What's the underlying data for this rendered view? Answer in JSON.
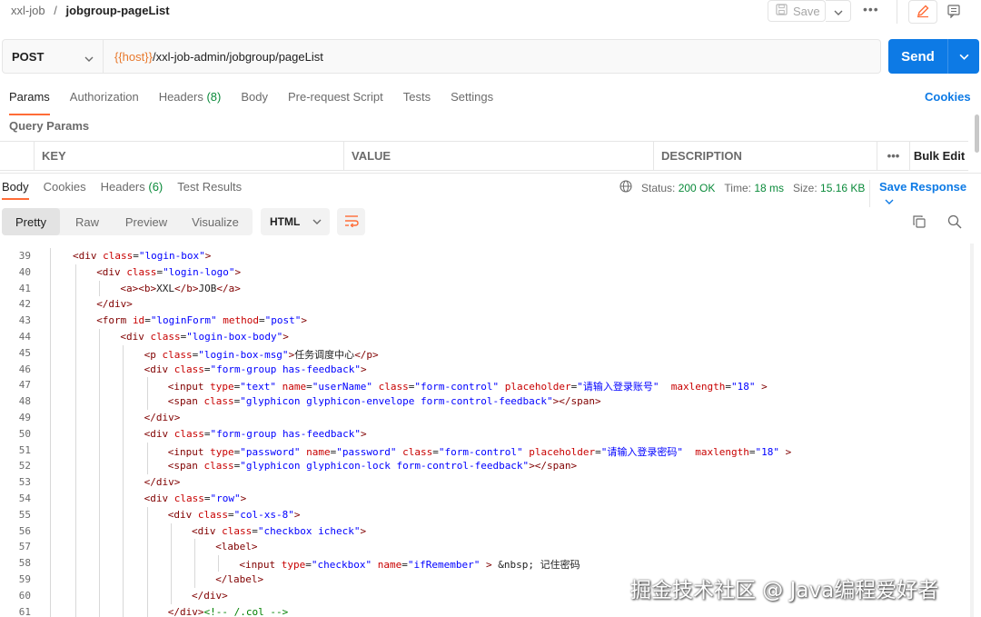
{
  "breadcrumb": {
    "collection": "xxl-job",
    "separator": "/",
    "request": "jobgroup-pageList"
  },
  "header": {
    "save_label": "Save",
    "more_label": "•••"
  },
  "request": {
    "method": "POST",
    "url_var": "{{host}}",
    "url_path": "/xxl-job-admin/jobgroup/pageList",
    "send_label": "Send"
  },
  "request_tabs": [
    {
      "label": "Params",
      "count": ""
    },
    {
      "label": "Authorization",
      "count": ""
    },
    {
      "label": "Headers",
      "count": "(8)"
    },
    {
      "label": "Body",
      "count": ""
    },
    {
      "label": "Pre-request Script",
      "count": ""
    },
    {
      "label": "Tests",
      "count": ""
    },
    {
      "label": "Settings",
      "count": ""
    }
  ],
  "cookies_label": "Cookies",
  "query_params_label": "Query Params",
  "params_table": {
    "key": "KEY",
    "value": "VALUE",
    "description": "DESCRIPTION",
    "more": "•••",
    "bulk_edit": "Bulk Edit"
  },
  "response_tabs": [
    {
      "label": "Body",
      "count": ""
    },
    {
      "label": "Cookies",
      "count": ""
    },
    {
      "label": "Headers",
      "count": "(6)"
    },
    {
      "label": "Test Results",
      "count": ""
    }
  ],
  "status": {
    "status_label": "Status:",
    "status_value": "200 OK",
    "time_label": "Time:",
    "time_value": "18 ms",
    "size_label": "Size:",
    "size_value": "15.16 KB"
  },
  "save_response_label": "Save Response",
  "view_modes": [
    "Pretty",
    "Raw",
    "Preview",
    "Visualize"
  ],
  "format": "HTML",
  "code_lines": [
    {
      "n": "39",
      "indent": 0,
      "html": "<span class=\"tag\">&lt;div</span> <span class=\"attr\">class</span>=<span class=\"val\">\"login-box\"</span><span class=\"tag\">&gt;</span>"
    },
    {
      "n": "40",
      "indent": 1,
      "html": "<span class=\"tag\">&lt;div</span> <span class=\"attr\">class</span>=<span class=\"val\">\"login-logo\"</span><span class=\"tag\">&gt;</span>"
    },
    {
      "n": "41",
      "indent": 2,
      "html": "<span class=\"tag\">&lt;a&gt;&lt;b&gt;</span>XXL<span class=\"tag\">&lt;/b&gt;</span>JOB<span class=\"tag\">&lt;/a&gt;</span>"
    },
    {
      "n": "42",
      "indent": 1,
      "html": "<span class=\"tag\">&lt;/div&gt;</span>"
    },
    {
      "n": "43",
      "indent": 1,
      "html": "<span class=\"tag\">&lt;form</span> <span class=\"attr\">id</span>=<span class=\"val\">\"loginForm\"</span> <span class=\"attr\">method</span>=<span class=\"val\">\"post\"</span><span class=\"tag\">&gt;</span>"
    },
    {
      "n": "44",
      "indent": 2,
      "html": "<span class=\"tag\">&lt;div</span> <span class=\"attr\">class</span>=<span class=\"val\">\"login-box-body\"</span><span class=\"tag\">&gt;</span>"
    },
    {
      "n": "45",
      "indent": 3,
      "html": "<span class=\"tag\">&lt;p</span> <span class=\"attr\">class</span>=<span class=\"val\">\"login-box-msg\"</span><span class=\"tag\">&gt;</span>任务调度中心<span class=\"tag\">&lt;/p&gt;</span>"
    },
    {
      "n": "46",
      "indent": 3,
      "html": "<span class=\"tag\">&lt;div</span> <span class=\"attr\">class</span>=<span class=\"val\">\"form-group has-feedback\"</span><span class=\"tag\">&gt;</span>"
    },
    {
      "n": "47",
      "indent": 4,
      "html": "<span class=\"tag\">&lt;input</span> <span class=\"attr\">type</span>=<span class=\"val\">\"text\"</span> <span class=\"attr\">name</span>=<span class=\"val\">\"userName\"</span> <span class=\"attr\">class</span>=<span class=\"val\">\"form-control\"</span> <span class=\"attr\">placeholder</span>=<span class=\"val\">\"请输入登录账号\"</span>  <span class=\"attr\">maxlength</span>=<span class=\"val\">\"18\"</span> <span class=\"tag\">&gt;</span>"
    },
    {
      "n": "48",
      "indent": 4,
      "html": "<span class=\"tag\">&lt;span</span> <span class=\"attr\">class</span>=<span class=\"val\">\"glyphicon glyphicon-envelope form-control-feedback\"</span><span class=\"tag\">&gt;&lt;/span&gt;</span>"
    },
    {
      "n": "49",
      "indent": 3,
      "html": "<span class=\"tag\">&lt;/div&gt;</span>"
    },
    {
      "n": "50",
      "indent": 3,
      "html": "<span class=\"tag\">&lt;div</span> <span class=\"attr\">class</span>=<span class=\"val\">\"form-group has-feedback\"</span><span class=\"tag\">&gt;</span>"
    },
    {
      "n": "51",
      "indent": 4,
      "html": "<span class=\"tag\">&lt;input</span> <span class=\"attr\">type</span>=<span class=\"val\">\"password\"</span> <span class=\"attr\">name</span>=<span class=\"val\">\"password\"</span> <span class=\"attr\">class</span>=<span class=\"val\">\"form-control\"</span> <span class=\"attr\">placeholder</span>=<span class=\"val\">\"请输入登录密码\"</span>  <span class=\"attr\">maxlength</span>=<span class=\"val\">\"18\"</span> <span class=\"tag\">&gt;</span>"
    },
    {
      "n": "52",
      "indent": 4,
      "html": "<span class=\"tag\">&lt;span</span> <span class=\"attr\">class</span>=<span class=\"val\">\"glyphicon glyphicon-lock form-control-feedback\"</span><span class=\"tag\">&gt;&lt;/span&gt;</span>"
    },
    {
      "n": "53",
      "indent": 3,
      "html": "<span class=\"tag\">&lt;/div&gt;</span>"
    },
    {
      "n": "54",
      "indent": 3,
      "html": "<span class=\"tag\">&lt;div</span> <span class=\"attr\">class</span>=<span class=\"val\">\"row\"</span><span class=\"tag\">&gt;</span>"
    },
    {
      "n": "55",
      "indent": 4,
      "html": "<span class=\"tag\">&lt;div</span> <span class=\"attr\">class</span>=<span class=\"val\">\"col-xs-8\"</span><span class=\"tag\">&gt;</span>"
    },
    {
      "n": "56",
      "indent": 5,
      "html": "<span class=\"tag\">&lt;div</span> <span class=\"attr\">class</span>=<span class=\"val\">\"checkbox icheck\"</span><span class=\"tag\">&gt;</span>"
    },
    {
      "n": "57",
      "indent": 6,
      "html": "<span class=\"tag\">&lt;label&gt;</span>"
    },
    {
      "n": "58",
      "indent": 7,
      "html": "<span class=\"tag\">&lt;input</span> <span class=\"attr\">type</span>=<span class=\"val\">\"checkbox\"</span> <span class=\"attr\">name</span>=<span class=\"val\">\"ifRemember\"</span> <span class=\"tag\">&gt;</span> &amp;nbsp; 记住密码"
    },
    {
      "n": "59",
      "indent": 6,
      "html": "<span class=\"tag\">&lt;/label&gt;</span>"
    },
    {
      "n": "60",
      "indent": 5,
      "html": "<span class=\"tag\">&lt;/div&gt;</span>"
    },
    {
      "n": "61",
      "indent": 4,
      "html": "<span class=\"tag\">&lt;/div&gt;</span><span class=\"cmt\">&lt;!-- /.col --&gt;</span>"
    }
  ],
  "watermark": "掘金技术社区 @ Java编程爱好者"
}
